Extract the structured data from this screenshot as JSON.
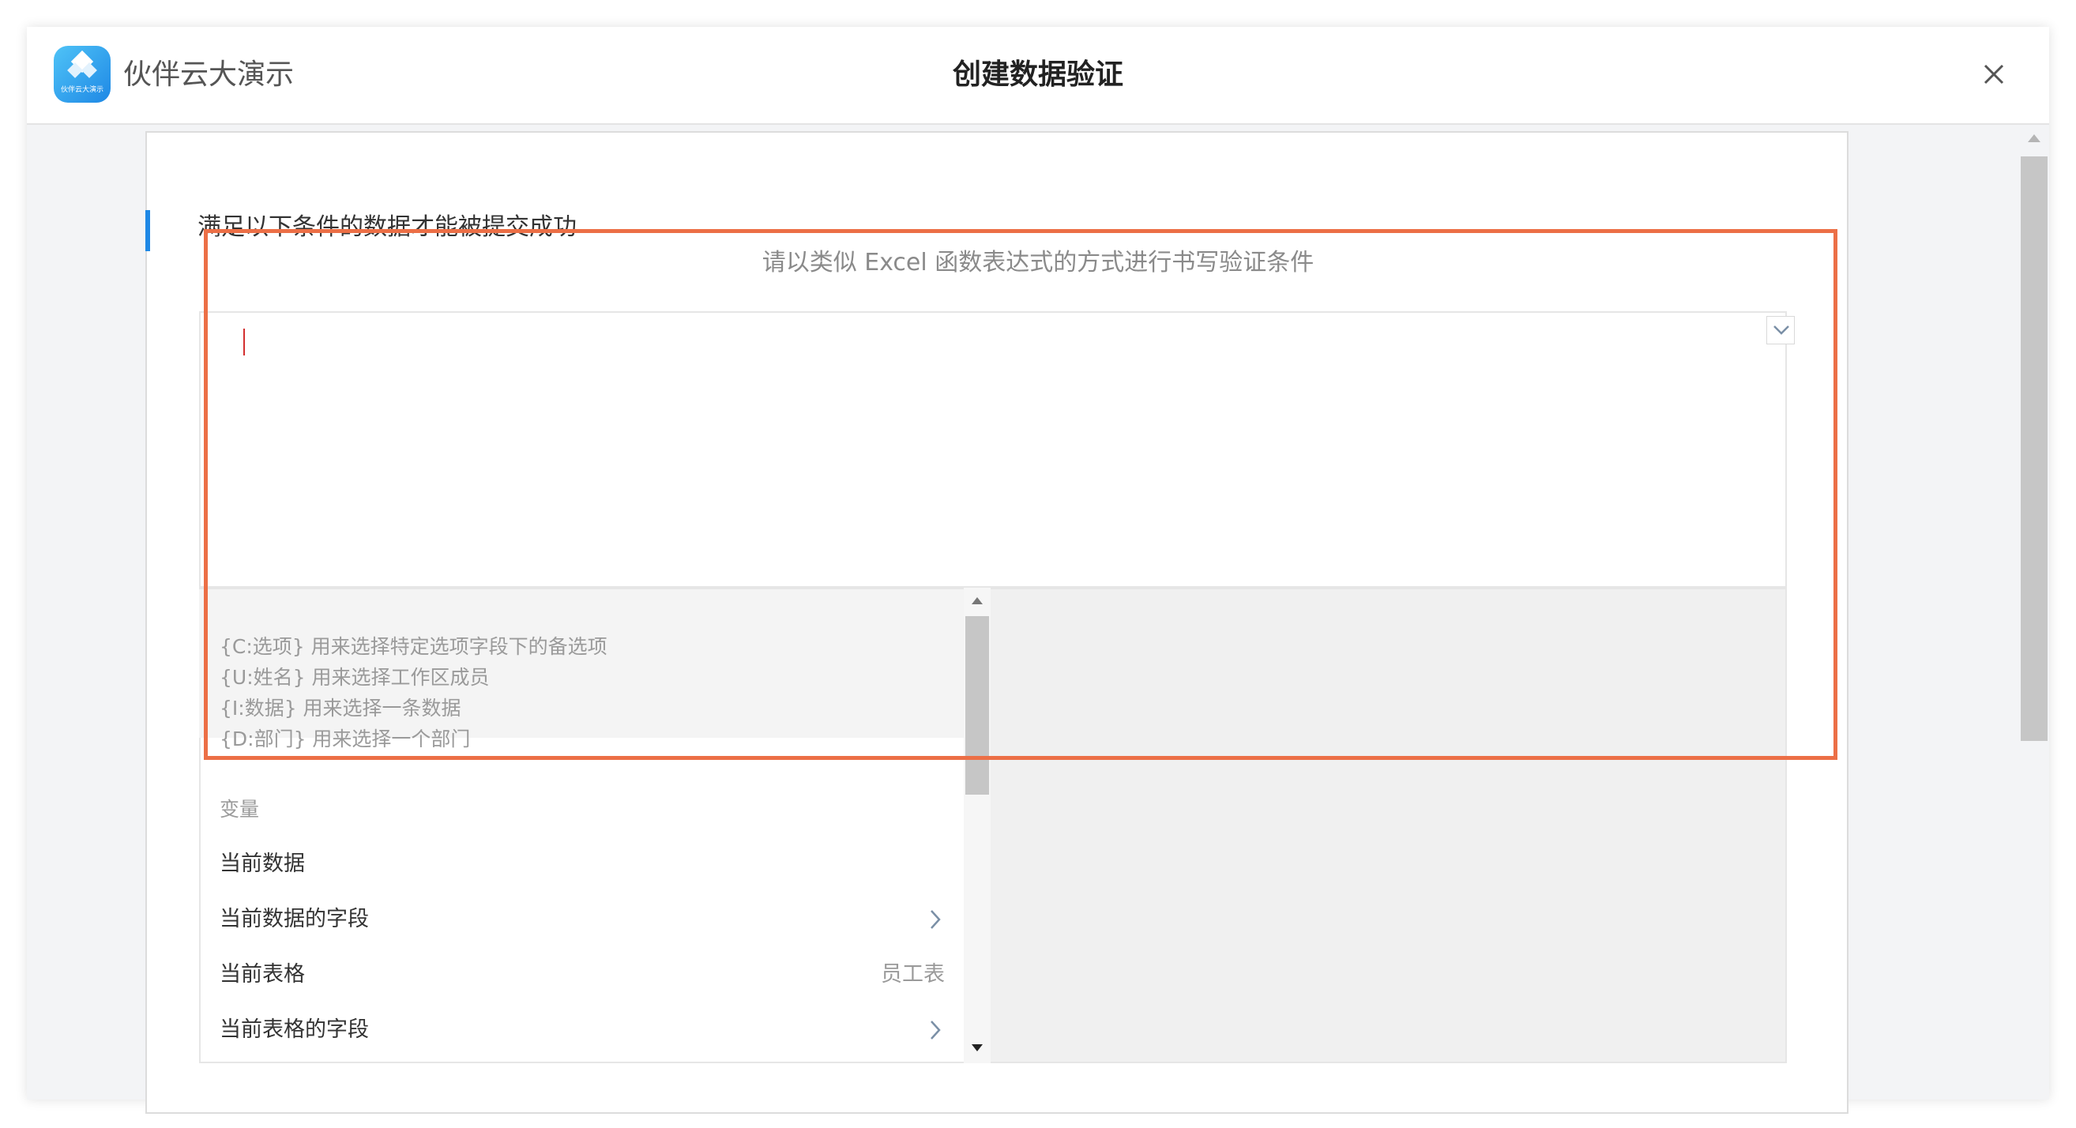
{
  "header": {
    "app_name": "伙伴云大演示",
    "logo_caption": "伙伴云大演示",
    "title": "创建数据验证"
  },
  "section": {
    "label": "满足以下条件的数据才能被提交成功",
    "subtitle": "请以类似 Excel 函数表达式的方式进行书写验证条件"
  },
  "editor": {
    "value": ""
  },
  "hints": [
    "{C:选项} 用来选择特定选项字段下的备选项",
    "{U:姓名} 用来选择工作区成员",
    "{I:数据} 用来选择一条数据",
    "{D:部门} 用来选择一个部门"
  ],
  "variables": {
    "header": "变量",
    "items": [
      {
        "label": "当前数据",
        "value": "",
        "has_submenu": false
      },
      {
        "label": "当前数据的字段",
        "value": "",
        "has_submenu": true
      },
      {
        "label": "当前表格",
        "value": "员工表",
        "has_submenu": false
      },
      {
        "label": "当前表格的字段",
        "value": "",
        "has_submenu": true
      }
    ]
  },
  "colors": {
    "accent": "#1e88e5",
    "highlight_border": "#ec6f46",
    "caret": "#d32f2f"
  },
  "icons": {
    "logo": "diamond-logo-icon",
    "close": "close-icon",
    "dropdown": "chevron-down-icon",
    "submenu": "chevron-right-icon"
  }
}
